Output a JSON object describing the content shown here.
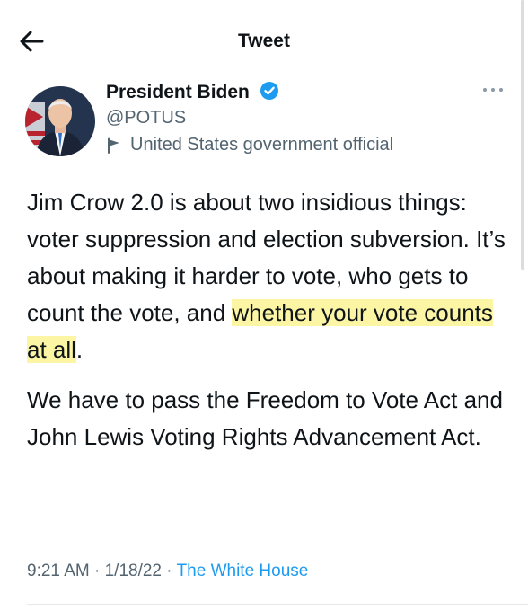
{
  "header": {
    "title": "Tweet"
  },
  "author": {
    "name": "President Biden",
    "handle": "@POTUS",
    "label": "United States government official"
  },
  "tweet": {
    "p1_text": "Jim Crow 2.0 is about two insidious things: voter suppression and election subversion. It’s about making it harder to vote, who gets to count the vote, and ",
    "p1_highlight": "whether your vote counts at all",
    "p1_end": ".",
    "p2": "We have to pass the Freedom to Vote Act and John Lewis Voting Rights Advancement Act."
  },
  "meta": {
    "time": "9:21 AM",
    "sep1": " · ",
    "date": "1/18/22",
    "sep2": " · ",
    "source": "The White House"
  },
  "colors": {
    "highlight": "#fbf5a4",
    "link": "#1d9bf0",
    "verified": "#1d9bf0",
    "secondary_text": "#536471"
  },
  "icons": [
    "back-arrow-icon",
    "verified-badge-icon",
    "more-icon",
    "flag-icon"
  ]
}
